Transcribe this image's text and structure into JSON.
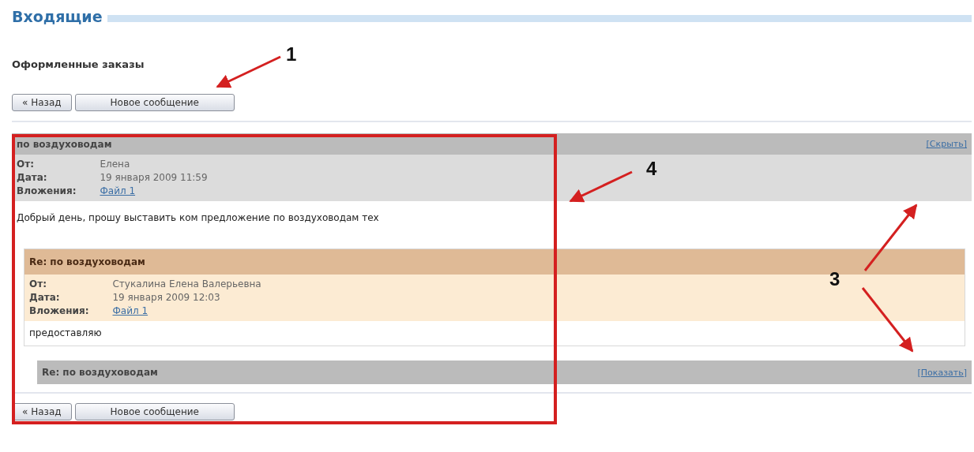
{
  "page": {
    "title": "Входящие",
    "subtitle": "Оформленные заказы"
  },
  "toolbar_top": [
    "« Назад",
    "Новое сообщение"
  ],
  "thread": {
    "subject": "по воздуховодам",
    "toggle": "[Скрыть]",
    "expanded": true,
    "fields": [
      {
        "label": "От:",
        "value": "Елена"
      },
      {
        "label": "Дата:",
        "value": "19 января 2009 11:59"
      },
      {
        "label": "Вложения:",
        "link": "Файл 1"
      }
    ],
    "body": "Добрый день, прошу выставить ком предложение по воздуховодам тех",
    "replies": [
      {
        "subject": "Re: по воздуховодам",
        "expanded": true,
        "fields": [
          {
            "label": "От:",
            "value": "Стукалина Елена Валерьевна"
          },
          {
            "label": "Дата:",
            "value": "19 января 2009 12:03"
          },
          {
            "label": "Вложения:",
            "link": "Файл 1"
          }
        ],
        "body": "предоставляю"
      },
      {
        "subject": "Re: по воздуховодам",
        "expanded": false,
        "toggle": "[Показать]"
      }
    ]
  },
  "toolbar_bottom": [
    "« Назад",
    "Новое сообщение"
  ],
  "annotations": [
    {
      "label": "1"
    },
    {
      "label": "4"
    },
    {
      "label": "3"
    }
  ]
}
